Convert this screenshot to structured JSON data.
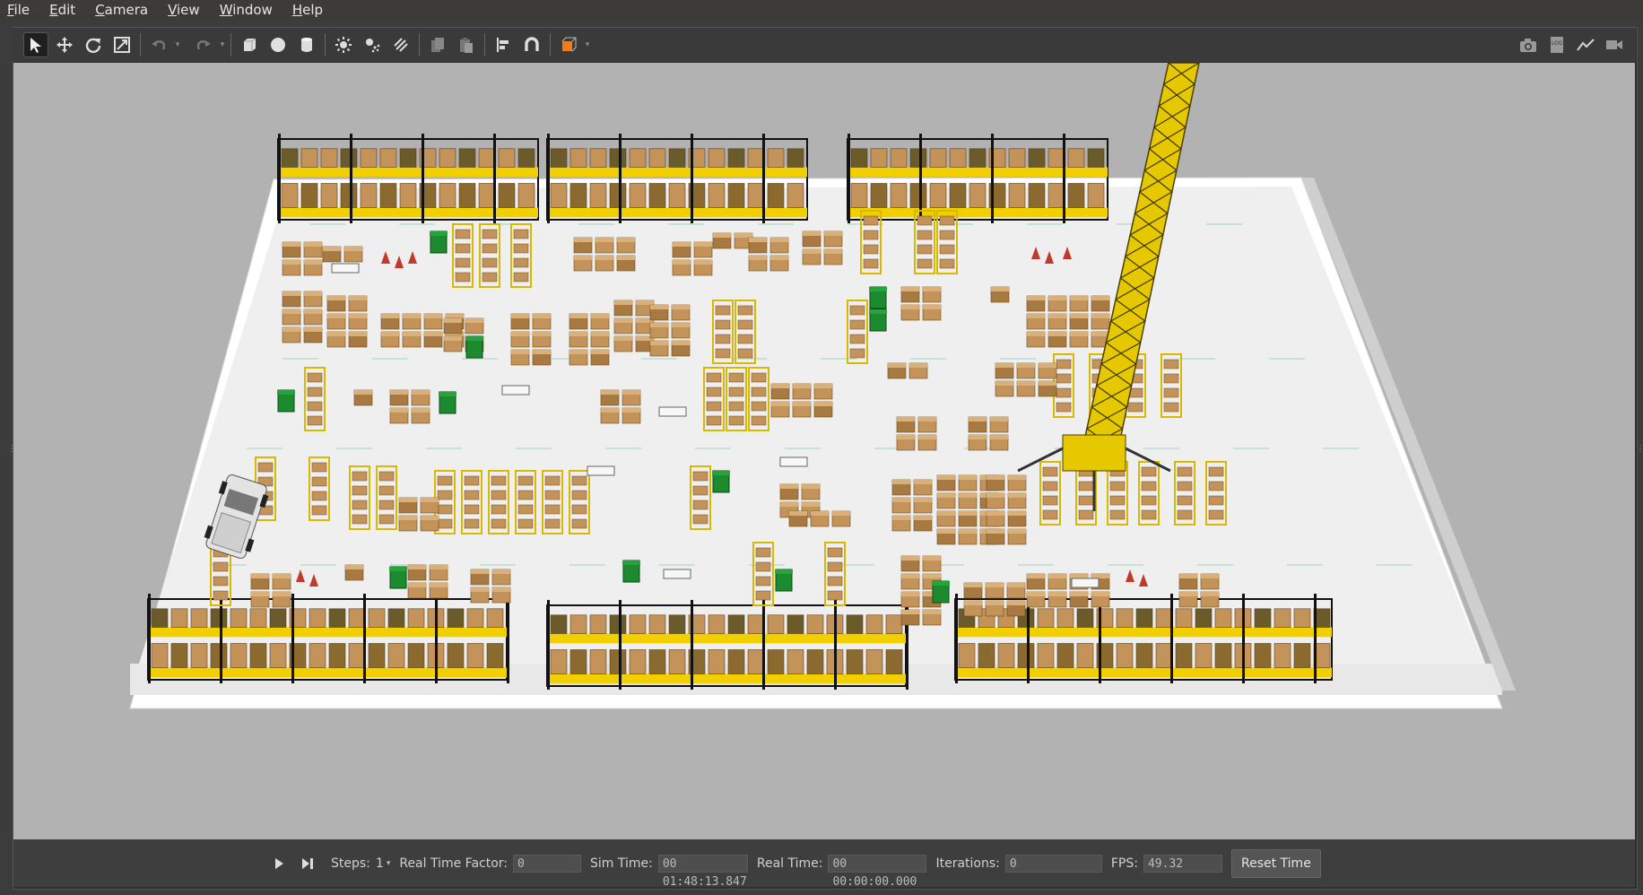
{
  "menu": [
    "File",
    "Edit",
    "Camera",
    "View",
    "Window",
    "Help"
  ],
  "toolbar": {
    "left_icons": [
      "select-arrow-icon",
      "translate-icon",
      "rotate-icon",
      "scale-icon",
      "undo-icon",
      "redo-icon",
      "box-shape-icon",
      "sphere-shape-icon",
      "cylinder-shape-icon",
      "point-light-icon",
      "spot-light-icon",
      "directional-light-icon",
      "copy-icon",
      "paste-icon",
      "align-icon",
      "snap-icon",
      "view-angle-icon"
    ],
    "right_icons": [
      "screenshot-icon",
      "log-icon",
      "plot-icon",
      "video-record-icon"
    ]
  },
  "bottom": {
    "steps_label": "Steps:",
    "steps_value": "1",
    "rtf_label": "Real Time Factor:",
    "rtf_value": "0",
    "sim_label": "Sim Time:",
    "sim_value": "00 01:48:13.847",
    "real_label": "Real Time:",
    "real_value": "00 00:00:00.000",
    "iter_label": "Iterations:",
    "iter_value": "0",
    "fps_label": "FPS:",
    "fps_value": "49.32",
    "reset_label": "Reset Time"
  },
  "colors": {
    "floor": "#efefef",
    "wall": "#ffffff",
    "shelf_yellow": "#f2d000",
    "box_brown": "#c4935a",
    "bin_green": "#1c8a2e",
    "sky": "#b2b2b2"
  }
}
